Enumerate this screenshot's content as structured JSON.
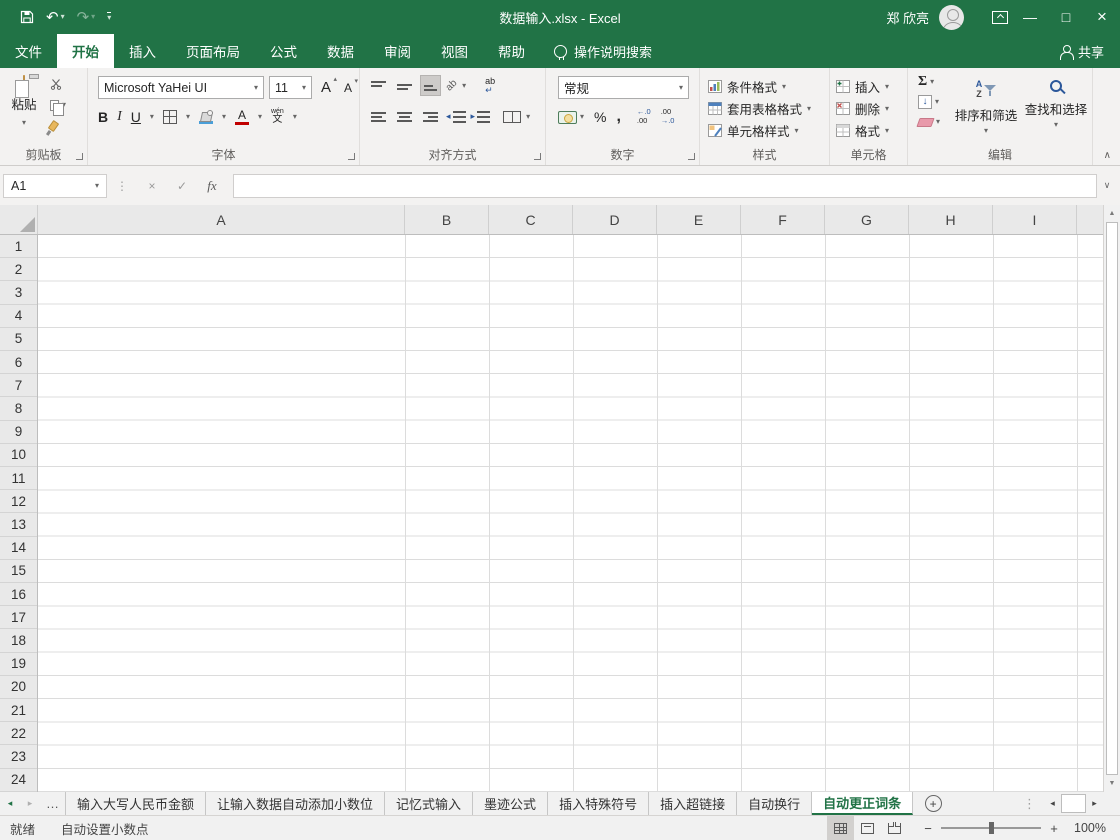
{
  "colors": {
    "brand": "#217346",
    "fill_color_bar": "#4a9fd8",
    "font_color_bar": "#c00000"
  },
  "glyphs": {
    "caret": "▾",
    "undo": "↶",
    "redo": "↷",
    "minimize": "—",
    "maximize": "□",
    "close": "×",
    "cancel": "×",
    "check": "✓",
    "fx": "fx",
    "dots_v": "⋮",
    "dots_h": "…",
    "expand_formula": "∨",
    "collapse_ribbon": "∧",
    "tri_up": "▲",
    "tri_down": "▼",
    "tri_left": "◂",
    "tri_right": "▸",
    "sigma": "Σ",
    "percent": "%",
    "comma": ",",
    "plus": "+",
    "minus": "−",
    "arrow_down": "↓",
    "arrow_return": "↵",
    "bold": "B",
    "italic": "I",
    "underline": "U",
    "letter_a": "A",
    "letter_z": "Z",
    "ab": "ab"
  },
  "titlebar": {
    "title": "数据输入.xlsx - Excel",
    "user": "郑 欣亮"
  },
  "tabs": [
    "文件",
    "开始",
    "插入",
    "页面布局",
    "公式",
    "数据",
    "审阅",
    "视图",
    "帮助"
  ],
  "search_label": "操作说明搜索",
  "share_label": "共享",
  "ribbon": {
    "clipboard": {
      "group": "剪贴板",
      "paste": "粘贴"
    },
    "font": {
      "group": "字体",
      "name": "Microsoft YaHei UI",
      "size": "11",
      "phonetic_top": "wén",
      "phonetic_bottom": "文"
    },
    "alignment": {
      "group": "对齐方式"
    },
    "number": {
      "group": "数字",
      "format": "常规",
      "inc_top": "←.0",
      "inc_bottom": ".00",
      "dec_top": ".00",
      "dec_bottom": "→.0"
    },
    "styles": {
      "group": "样式",
      "conditional": "条件格式",
      "format_table": "套用表格格式",
      "cell_styles": "单元格样式"
    },
    "cells": {
      "group": "单元格",
      "insert": "插入",
      "delete": "删除",
      "format": "格式"
    },
    "editing": {
      "group": "编辑",
      "sort": "排序和筛选",
      "find": "查找和选择"
    }
  },
  "formula_bar": {
    "name_box": "A1",
    "value": ""
  },
  "grid": {
    "columns": [
      "A",
      "B",
      "C",
      "D",
      "E",
      "F",
      "G",
      "H",
      "I"
    ],
    "rows": [
      "1",
      "2",
      "3",
      "4",
      "5",
      "6",
      "7",
      "8",
      "9",
      "10",
      "11",
      "12",
      "13",
      "14",
      "15",
      "16",
      "17",
      "18",
      "19",
      "20",
      "21",
      "22",
      "23",
      "24"
    ]
  },
  "sheets": {
    "tabs": [
      "输入大写人民币金额",
      "让输入数据自动添加小数位",
      "记忆式输入",
      "墨迹公式",
      "插入特殊符号",
      "插入超链接",
      "自动换行",
      "自动更正词条"
    ],
    "active": "自动更正词条"
  },
  "status": {
    "ready": "就绪",
    "mode": "自动设置小数点",
    "zoom": "100%"
  }
}
